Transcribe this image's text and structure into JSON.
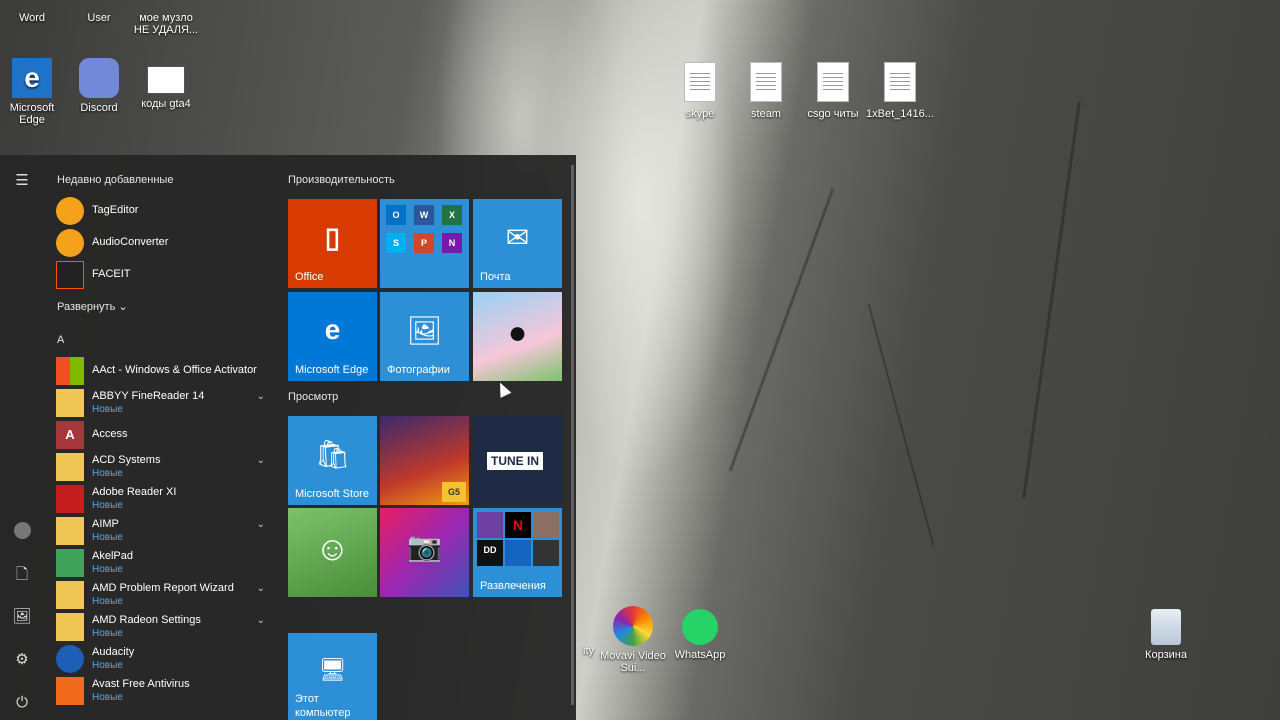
{
  "desktop": {
    "top_icons": [
      "Word",
      "User",
      "мое музло НЕ УДАЛЯ..."
    ],
    "row2": [
      "Microsoft Edge",
      "Discord",
      "коды gta4"
    ],
    "files": [
      "skype",
      "steam",
      "csgo читы",
      "1xBet_1416..."
    ],
    "bottom_icons": [
      "Movavi Video Sui...",
      "WhatsApp",
      "Корзина"
    ],
    "partial_label": "ity"
  },
  "start_menu": {
    "recent_header": "Недавно добавленные",
    "recent": [
      {
        "name": "TagEditor"
      },
      {
        "name": "AudioConverter"
      },
      {
        "name": "FACEIT"
      }
    ],
    "expand_label": "Развернуть",
    "letter": "A",
    "apps": [
      {
        "name": "AAct - Windows & Office Activator",
        "sub": ""
      },
      {
        "name": "ABBYY FineReader 14",
        "sub": "Новые"
      },
      {
        "name": "Access",
        "sub": ""
      },
      {
        "name": "ACD Systems",
        "sub": "Новые"
      },
      {
        "name": "Adobe Reader XI",
        "sub": "Новые"
      },
      {
        "name": "AIMP",
        "sub": "Новые"
      },
      {
        "name": "AkelPad",
        "sub": "Новые"
      },
      {
        "name": "AMD Problem Report Wizard",
        "sub": "Новые"
      },
      {
        "name": "AMD Radeon Settings",
        "sub": "Новые"
      },
      {
        "name": "Audacity",
        "sub": "Новые"
      },
      {
        "name": "Avast Free Antivirus",
        "sub": "Новые"
      }
    ],
    "groups": {
      "productivity": "Производительность",
      "browse": "Просмотр"
    },
    "tiles": {
      "office": "Office",
      "mail": "Почта",
      "edge": "Microsoft Edge",
      "photos": "Фотографии",
      "store": "Microsoft Store",
      "entertainment": "Развлечения",
      "this_pc": "Этот компьютер",
      "tunein": "TUNE IN"
    }
  },
  "colors": {
    "accent": "#2d8fd5",
    "office": "#d83b01",
    "new_label": "#5aa7e6"
  }
}
